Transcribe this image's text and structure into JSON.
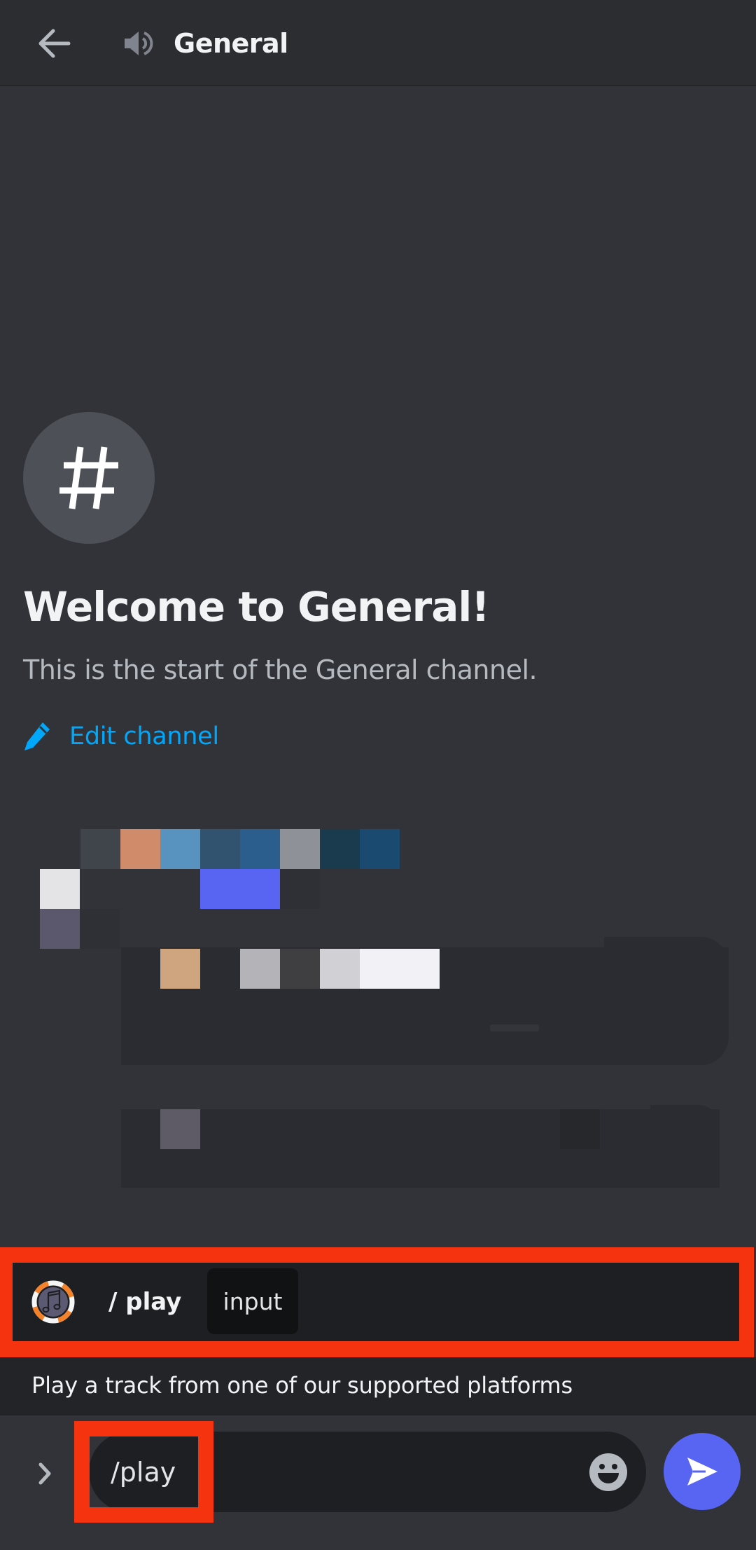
{
  "header": {
    "back_icon": "arrow-left-icon",
    "channel_icon": "speaker-icon",
    "title": "General"
  },
  "welcome": {
    "icon": "hash-icon",
    "title": "Welcome to General!",
    "subtitle": "This is the start of the General channel.",
    "edit_icon": "pencil-icon",
    "edit_label": "Edit channel"
  },
  "redacted_area": {
    "note": "pixelated content",
    "colors": {
      "row_a": [
        "#40444b",
        "#d08b6a",
        "#5893c0",
        "#32536f",
        "#2b5e8c",
        "#8e9197",
        "#1a3a4e",
        "#1a4a70"
      ],
      "row_b_left": "#e4e4e6",
      "row_b_accent": "#5865f2",
      "row_c_left": "#5b586d",
      "row_d": [
        "#cfa57f",
        "#b3b3b8",
        "#3f3f42",
        "#d0d0d5",
        "#f2f2f6"
      ],
      "card2_block": "#5e5a66"
    }
  },
  "autocomplete": {
    "bot_icon": "music-bot-avatar-icon",
    "command": "/ play",
    "option_chip": "input",
    "description": "Play a track from one of our supported platforms"
  },
  "composer": {
    "expand_icon": "chevron-right-icon",
    "value": "/play",
    "emoji_icon": "emoji-icon",
    "send_icon": "send-icon"
  },
  "colors": {
    "background": "#313338",
    "header": "#2b2d31",
    "link": "#00a8fc",
    "accent": "#5865f2",
    "annotation_highlight": "#f5330f"
  }
}
